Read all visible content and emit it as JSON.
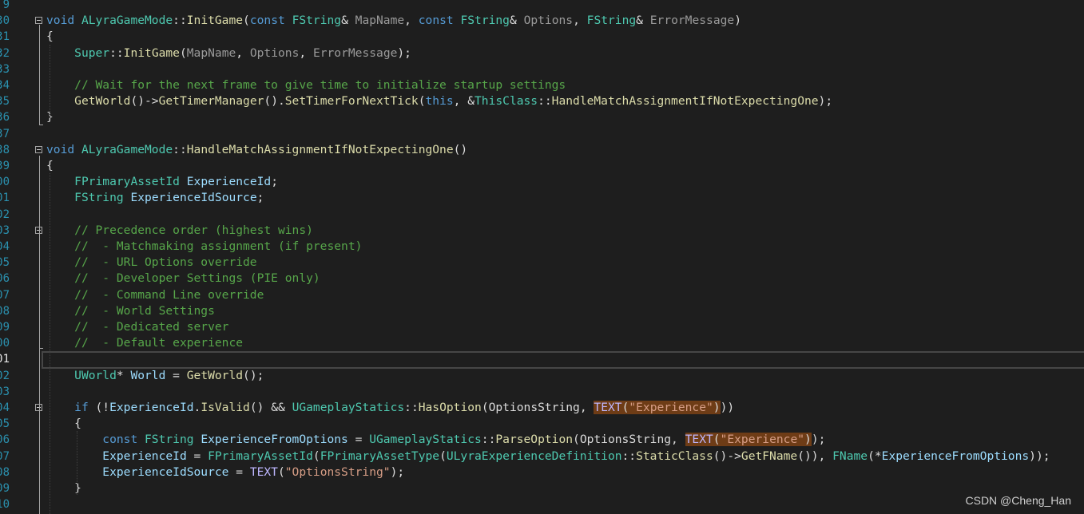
{
  "editor": {
    "active_line": "01",
    "watermark": "CSDN @Cheng_Han"
  },
  "lines": [
    {
      "num": "9",
      "segs": []
    },
    {
      "num": "30",
      "segs": [
        {
          "t": "void ",
          "c": "kw"
        },
        {
          "t": "ALyraGameMode",
          "c": "ty"
        },
        {
          "t": "::",
          "c": "pl"
        },
        {
          "t": "InitGame",
          "c": "fn"
        },
        {
          "t": "(",
          "c": "pl"
        },
        {
          "t": "const ",
          "c": "kw"
        },
        {
          "t": "FString",
          "c": "ty"
        },
        {
          "t": "& ",
          "c": "pl"
        },
        {
          "t": "MapName",
          "c": "pm"
        },
        {
          "t": ", ",
          "c": "pl"
        },
        {
          "t": "const ",
          "c": "kw"
        },
        {
          "t": "FString",
          "c": "ty"
        },
        {
          "t": "& ",
          "c": "pl"
        },
        {
          "t": "Options",
          "c": "pm"
        },
        {
          "t": ", ",
          "c": "pl"
        },
        {
          "t": "FString",
          "c": "ty"
        },
        {
          "t": "& ",
          "c": "pl"
        },
        {
          "t": "ErrorMessage",
          "c": "pm"
        },
        {
          "t": ")",
          "c": "pl"
        }
      ]
    },
    {
      "num": "31",
      "segs": [
        {
          "t": "{",
          "c": "pl"
        }
      ]
    },
    {
      "num": "32",
      "segs": [
        {
          "t": "    ",
          "c": "pl"
        },
        {
          "t": "Super",
          "c": "ty"
        },
        {
          "t": "::",
          "c": "pl"
        },
        {
          "t": "InitGame",
          "c": "fn"
        },
        {
          "t": "(",
          "c": "pl"
        },
        {
          "t": "MapName",
          "c": "pm"
        },
        {
          "t": ", ",
          "c": "pl"
        },
        {
          "t": "Options",
          "c": "pm"
        },
        {
          "t": ", ",
          "c": "pl"
        },
        {
          "t": "ErrorMessage",
          "c": "pm"
        },
        {
          "t": ");",
          "c": "pl"
        }
      ]
    },
    {
      "num": "33",
      "segs": []
    },
    {
      "num": "34",
      "segs": [
        {
          "t": "    ",
          "c": "pl"
        },
        {
          "t": "// Wait for the next frame to give time to initialize startup settings",
          "c": "cm"
        }
      ]
    },
    {
      "num": "35",
      "segs": [
        {
          "t": "    ",
          "c": "pl"
        },
        {
          "t": "GetWorld",
          "c": "fn"
        },
        {
          "t": "()->",
          "c": "pl"
        },
        {
          "t": "GetTimerManager",
          "c": "fn"
        },
        {
          "t": "().",
          "c": "pl"
        },
        {
          "t": "SetTimerForNextTick",
          "c": "fn"
        },
        {
          "t": "(",
          "c": "pl"
        },
        {
          "t": "this",
          "c": "kw"
        },
        {
          "t": ", &",
          "c": "pl"
        },
        {
          "t": "ThisClass",
          "c": "ty"
        },
        {
          "t": "::",
          "c": "pl"
        },
        {
          "t": "HandleMatchAssignmentIfNotExpectingOne",
          "c": "fn"
        },
        {
          "t": ");",
          "c": "pl"
        }
      ]
    },
    {
      "num": "36",
      "segs": [
        {
          "t": "}",
          "c": "pl"
        }
      ]
    },
    {
      "num": "37",
      "segs": []
    },
    {
      "num": "38",
      "segs": [
        {
          "t": "void ",
          "c": "kw"
        },
        {
          "t": "ALyraGameMode",
          "c": "ty"
        },
        {
          "t": "::",
          "c": "pl"
        },
        {
          "t": "HandleMatchAssignmentIfNotExpectingOne",
          "c": "fn"
        },
        {
          "t": "()",
          "c": "pl"
        }
      ]
    },
    {
      "num": "39",
      "segs": [
        {
          "t": "{",
          "c": "pl"
        }
      ]
    },
    {
      "num": "00",
      "segs": [
        {
          "t": "    ",
          "c": "pl"
        },
        {
          "t": "FPrimaryAssetId",
          "c": "ty"
        },
        {
          "t": " ",
          "c": "pl"
        },
        {
          "t": "ExperienceId",
          "c": "vr"
        },
        {
          "t": ";",
          "c": "pl"
        }
      ]
    },
    {
      "num": "01",
      "segs": [
        {
          "t": "    ",
          "c": "pl"
        },
        {
          "t": "FString",
          "c": "ty"
        },
        {
          "t": " ",
          "c": "pl"
        },
        {
          "t": "ExperienceIdSource",
          "c": "vr"
        },
        {
          "t": ";",
          "c": "pl"
        }
      ]
    },
    {
      "num": "02",
      "segs": []
    },
    {
      "num": "03",
      "segs": [
        {
          "t": "    ",
          "c": "pl"
        },
        {
          "t": "// Precedence order (highest wins)",
          "c": "cm"
        }
      ]
    },
    {
      "num": "04",
      "segs": [
        {
          "t": "    ",
          "c": "pl"
        },
        {
          "t": "//  - Matchmaking assignment (if present)",
          "c": "cm"
        }
      ]
    },
    {
      "num": "05",
      "segs": [
        {
          "t": "    ",
          "c": "pl"
        },
        {
          "t": "//  - URL Options override",
          "c": "cm"
        }
      ]
    },
    {
      "num": "06",
      "segs": [
        {
          "t": "    ",
          "c": "pl"
        },
        {
          "t": "//  - Developer Settings (PIE only)",
          "c": "cm"
        }
      ]
    },
    {
      "num": "07",
      "segs": [
        {
          "t": "    ",
          "c": "pl"
        },
        {
          "t": "//  - Command Line override",
          "c": "cm"
        }
      ]
    },
    {
      "num": "08",
      "segs": [
        {
          "t": "    ",
          "c": "pl"
        },
        {
          "t": "//  - World Settings",
          "c": "cm"
        }
      ]
    },
    {
      "num": "09",
      "segs": [
        {
          "t": "    ",
          "c": "pl"
        },
        {
          "t": "//  - Dedicated server",
          "c": "cm"
        }
      ]
    },
    {
      "num": "00",
      "segs": [
        {
          "t": "    ",
          "c": "pl"
        },
        {
          "t": "//  - Default experience",
          "c": "cm"
        }
      ]
    },
    {
      "num": "01",
      "segs": []
    },
    {
      "num": "02",
      "segs": [
        {
          "t": "    ",
          "c": "pl"
        },
        {
          "t": "UWorld",
          "c": "ty"
        },
        {
          "t": "* ",
          "c": "pl"
        },
        {
          "t": "World",
          "c": "vr"
        },
        {
          "t": " = ",
          "c": "pl"
        },
        {
          "t": "GetWorld",
          "c": "fn"
        },
        {
          "t": "();",
          "c": "pl"
        }
      ]
    },
    {
      "num": "03",
      "segs": []
    },
    {
      "num": "04",
      "segs": [
        {
          "t": "    ",
          "c": "pl"
        },
        {
          "t": "if",
          "c": "kw"
        },
        {
          "t": " (!",
          "c": "pl"
        },
        {
          "t": "ExperienceId",
          "c": "vr"
        },
        {
          "t": ".",
          "c": "pl"
        },
        {
          "t": "IsValid",
          "c": "fn"
        },
        {
          "t": "() && ",
          "c": "pl"
        },
        {
          "t": "UGameplayStatics",
          "c": "ty"
        },
        {
          "t": "::",
          "c": "pl"
        },
        {
          "t": "HasOption",
          "c": "fn"
        },
        {
          "t": "(OptionsString, ",
          "c": "pl"
        },
        {
          "t": "TEXT",
          "c": "mc",
          "hl": true
        },
        {
          "t": "(",
          "c": "pl",
          "hl": true
        },
        {
          "t": "\"Experience\"",
          "c": "st",
          "hl": true
        },
        {
          "t": ")",
          "c": "pl",
          "hl": true
        },
        {
          "t": "))",
          "c": "pl"
        }
      ]
    },
    {
      "num": "05",
      "segs": [
        {
          "t": "    {",
          "c": "pl"
        }
      ]
    },
    {
      "num": "06",
      "segs": [
        {
          "t": "        ",
          "c": "pl"
        },
        {
          "t": "const ",
          "c": "kw"
        },
        {
          "t": "FString",
          "c": "ty"
        },
        {
          "t": " ",
          "c": "pl"
        },
        {
          "t": "ExperienceFromOptions",
          "c": "vr"
        },
        {
          "t": " = ",
          "c": "pl"
        },
        {
          "t": "UGameplayStatics",
          "c": "ty"
        },
        {
          "t": "::",
          "c": "pl"
        },
        {
          "t": "ParseOption",
          "c": "fn"
        },
        {
          "t": "(OptionsString, ",
          "c": "pl"
        },
        {
          "t": "TEXT",
          "c": "mc",
          "hl": true
        },
        {
          "t": "(",
          "c": "pl",
          "hl": true
        },
        {
          "t": "\"Experience\"",
          "c": "st",
          "hl": true
        },
        {
          "t": ")",
          "c": "pl",
          "hl": true
        },
        {
          "t": ");",
          "c": "pl"
        }
      ]
    },
    {
      "num": "07",
      "segs": [
        {
          "t": "        ",
          "c": "pl"
        },
        {
          "t": "ExperienceId",
          "c": "vr"
        },
        {
          "t": " = ",
          "c": "pl"
        },
        {
          "t": "FPrimaryAssetId",
          "c": "ty"
        },
        {
          "t": "(",
          "c": "pl"
        },
        {
          "t": "FPrimaryAssetType",
          "c": "ty"
        },
        {
          "t": "(",
          "c": "pl"
        },
        {
          "t": "ULyraExperienceDefinition",
          "c": "ty"
        },
        {
          "t": "::",
          "c": "pl"
        },
        {
          "t": "StaticClass",
          "c": "fn"
        },
        {
          "t": "()->",
          "c": "pl"
        },
        {
          "t": "GetFName",
          "c": "fn"
        },
        {
          "t": "()), ",
          "c": "pl"
        },
        {
          "t": "FName",
          "c": "ty"
        },
        {
          "t": "(*",
          "c": "pl"
        },
        {
          "t": "ExperienceFromOptions",
          "c": "vr"
        },
        {
          "t": "));",
          "c": "pl"
        }
      ]
    },
    {
      "num": "08",
      "segs": [
        {
          "t": "        ",
          "c": "pl"
        },
        {
          "t": "ExperienceIdSource",
          "c": "vr"
        },
        {
          "t": " = ",
          "c": "pl"
        },
        {
          "t": "TEXT",
          "c": "mc"
        },
        {
          "t": "(",
          "c": "pl"
        },
        {
          "t": "\"OptionsString\"",
          "c": "st"
        },
        {
          "t": ");",
          "c": "pl"
        }
      ]
    },
    {
      "num": "09",
      "segs": [
        {
          "t": "    }",
          "c": "pl"
        }
      ]
    },
    {
      "num": "10",
      "segs": []
    }
  ]
}
